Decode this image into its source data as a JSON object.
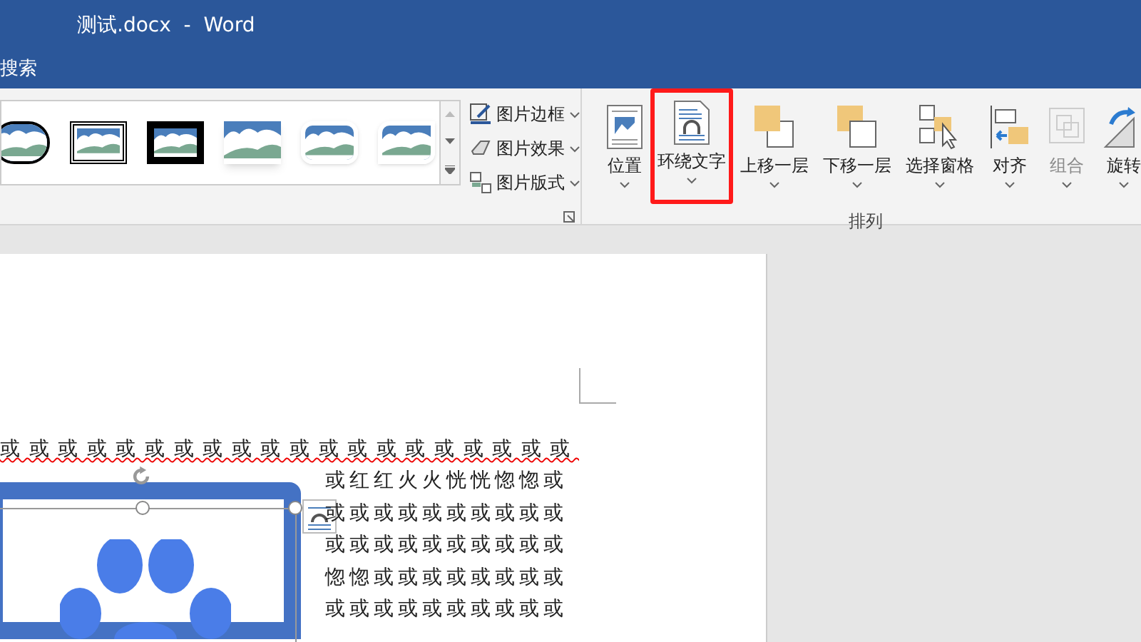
{
  "window": {
    "title": "测试.docx  -  Word"
  },
  "search": {
    "label": "搜索"
  },
  "picture_styles": {
    "commands": [
      {
        "label": "图片边框"
      },
      {
        "label": "图片效果"
      },
      {
        "label": "图片版式"
      }
    ]
  },
  "arrange": {
    "buttons": [
      {
        "label": "位置",
        "disabled": false,
        "highlighted": false
      },
      {
        "label": "环绕文字",
        "disabled": false,
        "highlighted": true
      },
      {
        "label": "上移一层",
        "disabled": false,
        "highlighted": false
      },
      {
        "label": "下移一层",
        "disabled": false,
        "highlighted": false
      },
      {
        "label": "选择窗格",
        "disabled": false,
        "highlighted": false
      },
      {
        "label": "对齐",
        "disabled": false,
        "highlighted": false
      },
      {
        "label": "组合",
        "disabled": true,
        "highlighted": false
      },
      {
        "label": "旋转",
        "disabled": false,
        "highlighted": false
      }
    ],
    "group_label": "排列"
  },
  "document": {
    "first_line": {
      "text": "或或或或或或或或或或或或或或或或或或或或",
      "spell_error": true
    },
    "wrapped_lines": [
      "或红红火火恍恍惚惚或",
      "或或或或或或或或或或",
      "或或或或或或或或或或",
      "惚惚或或或或或或或或",
      "或或或或或或或或或或"
    ]
  }
}
